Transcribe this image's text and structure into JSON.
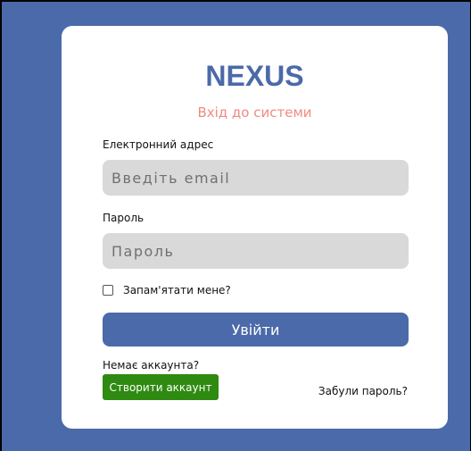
{
  "app": {
    "brand": "NEXUS",
    "subtitle": "Вхід до системи"
  },
  "form": {
    "email": {
      "label": "Електронний адрес",
      "placeholder": "Введіть email",
      "value": ""
    },
    "password": {
      "label": "Пароль",
      "placeholder": "Пароль",
      "value": ""
    },
    "remember": {
      "label": "Запам'ятати мене?",
      "checked": false
    },
    "login_label": "Увійти"
  },
  "footer": {
    "no_account": "Немає аккаунта?",
    "create_label": "Створити аккаунт",
    "forgot_label": "Забули пароль?"
  },
  "colors": {
    "background": "#4b6aa9",
    "primary": "#4b6aa9",
    "subtitle": "#f08a84",
    "input_bg": "#d9d9d9",
    "create_button": "#2f8a11"
  }
}
